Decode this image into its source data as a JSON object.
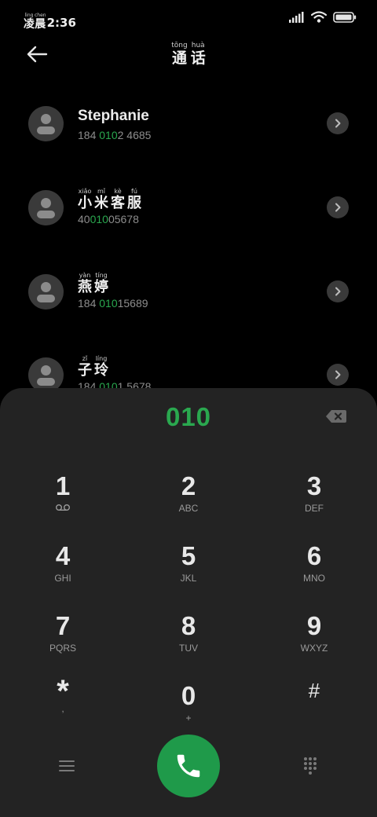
{
  "status_bar": {
    "time_prefix": [
      {
        "pinyin": "ling",
        "hanzi": "凌"
      },
      {
        "pinyin": "chen",
        "hanzi": "晨"
      }
    ],
    "clock": "2:36",
    "icons": [
      "signal-icon",
      "wifi-icon",
      "battery-icon"
    ]
  },
  "header": {
    "title": [
      {
        "pinyin": "tōng",
        "hanzi": "通"
      },
      {
        "pinyin": "huà",
        "hanzi": "话"
      }
    ]
  },
  "contacts": [
    {
      "name": "Stephanie",
      "number_pre": "184 ",
      "number_match": "010",
      "number_post": "2 4685"
    },
    {
      "name_ruby": [
        {
          "pinyin": "xiǎo",
          "hanzi": "小"
        },
        {
          "pinyin": "mǐ",
          "hanzi": "米"
        },
        {
          "pinyin": "kè",
          "hanzi": "客"
        },
        {
          "pinyin": "fú",
          "hanzi": "服"
        }
      ],
      "number_pre": "40",
      "number_match": "010",
      "number_post": "05678"
    },
    {
      "name_ruby": [
        {
          "pinyin": "yàn",
          "hanzi": "燕"
        },
        {
          "pinyin": "tíng",
          "hanzi": "婷"
        }
      ],
      "number_pre": "184 ",
      "number_match": "010",
      "number_post": "15689"
    },
    {
      "name_ruby": [
        {
          "pinyin": "zǐ",
          "hanzi": "子"
        },
        {
          "pinyin": "líng",
          "hanzi": "玲"
        }
      ],
      "number_pre": "184 ",
      "number_match": "010",
      "number_post": "1 5678"
    }
  ],
  "dialer": {
    "input": "010",
    "keys": [
      {
        "digit": "1",
        "letters": ""
      },
      {
        "digit": "2",
        "letters": "ABC"
      },
      {
        "digit": "3",
        "letters": "DEF"
      },
      {
        "digit": "4",
        "letters": "GHI"
      },
      {
        "digit": "5",
        "letters": "JKL"
      },
      {
        "digit": "6",
        "letters": "MNO"
      },
      {
        "digit": "7",
        "letters": "PQRS"
      },
      {
        "digit": "8",
        "letters": "TUV"
      },
      {
        "digit": "9",
        "letters": "WXYZ"
      },
      {
        "digit": "*",
        "letters": ","
      },
      {
        "digit": "0",
        "letters": "+"
      },
      {
        "digit": "#",
        "letters": ""
      }
    ]
  },
  "colors": {
    "background": "#000000",
    "panel": "#232323",
    "accent_green": "#2aa84f",
    "call_button": "#1f9a4a"
  }
}
